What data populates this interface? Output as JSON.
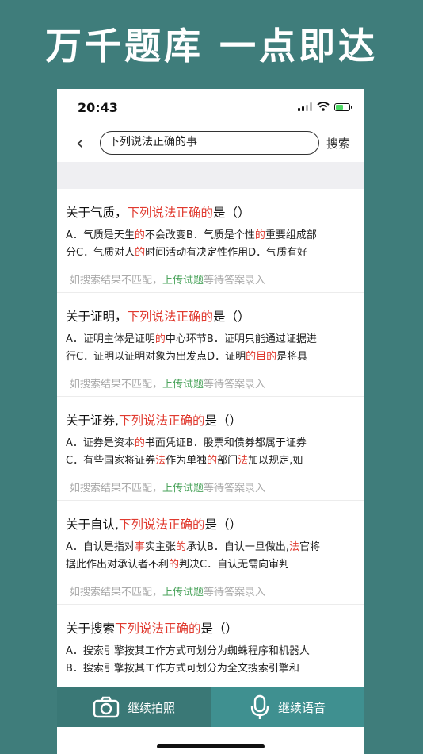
{
  "banner": "万千题库 一点即达",
  "status": {
    "time": "20:43"
  },
  "search": {
    "value": "下列说法正确的事",
    "button": "搜索"
  },
  "results": [
    {
      "question": [
        [
          "关于气质，",
          ""
        ],
        [
          "下列说法正确的",
          "hl"
        ],
        [
          "是（）",
          ""
        ]
      ],
      "answer": [
        [
          [
            "A．气质是天生",
            ""
          ],
          [
            "的",
            "hl"
          ],
          [
            "不会改变B．气质是个性",
            ""
          ],
          [
            "的",
            "hl"
          ],
          [
            "重要组成部",
            ""
          ]
        ],
        [
          [
            "分C．气质对人",
            ""
          ],
          [
            "的",
            "hl"
          ],
          [
            "时间活动有决定性作用D．气质有好",
            ""
          ]
        ]
      ]
    },
    {
      "question": [
        [
          "关于证明，",
          ""
        ],
        [
          "下列说法正确的",
          "hl"
        ],
        [
          "是（）",
          ""
        ]
      ],
      "answer": [
        [
          [
            "A．证明主体是证明",
            ""
          ],
          [
            "的",
            "hl"
          ],
          [
            "中心环节B．证明只能通过证据进",
            ""
          ]
        ],
        [
          [
            "行C．证明以证明对象为出发点D．证明",
            ""
          ],
          [
            "的",
            "hl"
          ],
          [
            "目",
            "hl"
          ],
          [
            "的",
            "hl"
          ],
          [
            "是将具",
            ""
          ]
        ]
      ]
    },
    {
      "question": [
        [
          "关于证券,",
          ""
        ],
        [
          "下列说法正确的",
          "hl"
        ],
        [
          "是（）",
          ""
        ]
      ],
      "answer": [
        [
          [
            "A．证券是资本",
            ""
          ],
          [
            "的",
            "hl"
          ],
          [
            "书面凭证B．股票和债券都属于证券",
            ""
          ]
        ],
        [
          [
            "C．有些国家将证券",
            ""
          ],
          [
            "法",
            "hl"
          ],
          [
            "作为单独",
            ""
          ],
          [
            "的",
            "hl"
          ],
          [
            "部门",
            ""
          ],
          [
            "法",
            "hl"
          ],
          [
            "加以规定,如",
            ""
          ]
        ]
      ]
    },
    {
      "question": [
        [
          "关于自认,",
          ""
        ],
        [
          "下列说法正确的",
          "hl"
        ],
        [
          "是（）",
          ""
        ]
      ],
      "answer": [
        [
          [
            "A．自认是指对",
            ""
          ],
          [
            "事",
            "hl"
          ],
          [
            "实主张",
            ""
          ],
          [
            "的",
            "hl"
          ],
          [
            "承认B．自认一旦做出,",
            ""
          ],
          [
            "法",
            "hl"
          ],
          [
            "官将",
            ""
          ]
        ],
        [
          [
            "据此作出对承认者不利",
            ""
          ],
          [
            "的",
            "hl"
          ],
          [
            "判决C．自认无需向审判",
            ""
          ]
        ]
      ]
    },
    {
      "question": [
        [
          "关于搜索",
          ""
        ],
        [
          "下列说法正确的",
          "hl"
        ],
        [
          "是（）",
          ""
        ]
      ],
      "answer": [
        [
          [
            "A．搜索引擎按其工作方式可划分为蜘蛛程序和机器人",
            ""
          ]
        ],
        [
          [
            "B．搜索引擎按其工作方式可划分为全文搜索引擎和",
            ""
          ]
        ]
      ]
    }
  ],
  "hint": {
    "prefix": "如搜索结果不匹配，",
    "link": "上传试题",
    "suffix": "等待答案录入"
  },
  "bottom": {
    "photo": "继续拍照",
    "voice": "继续语音"
  }
}
